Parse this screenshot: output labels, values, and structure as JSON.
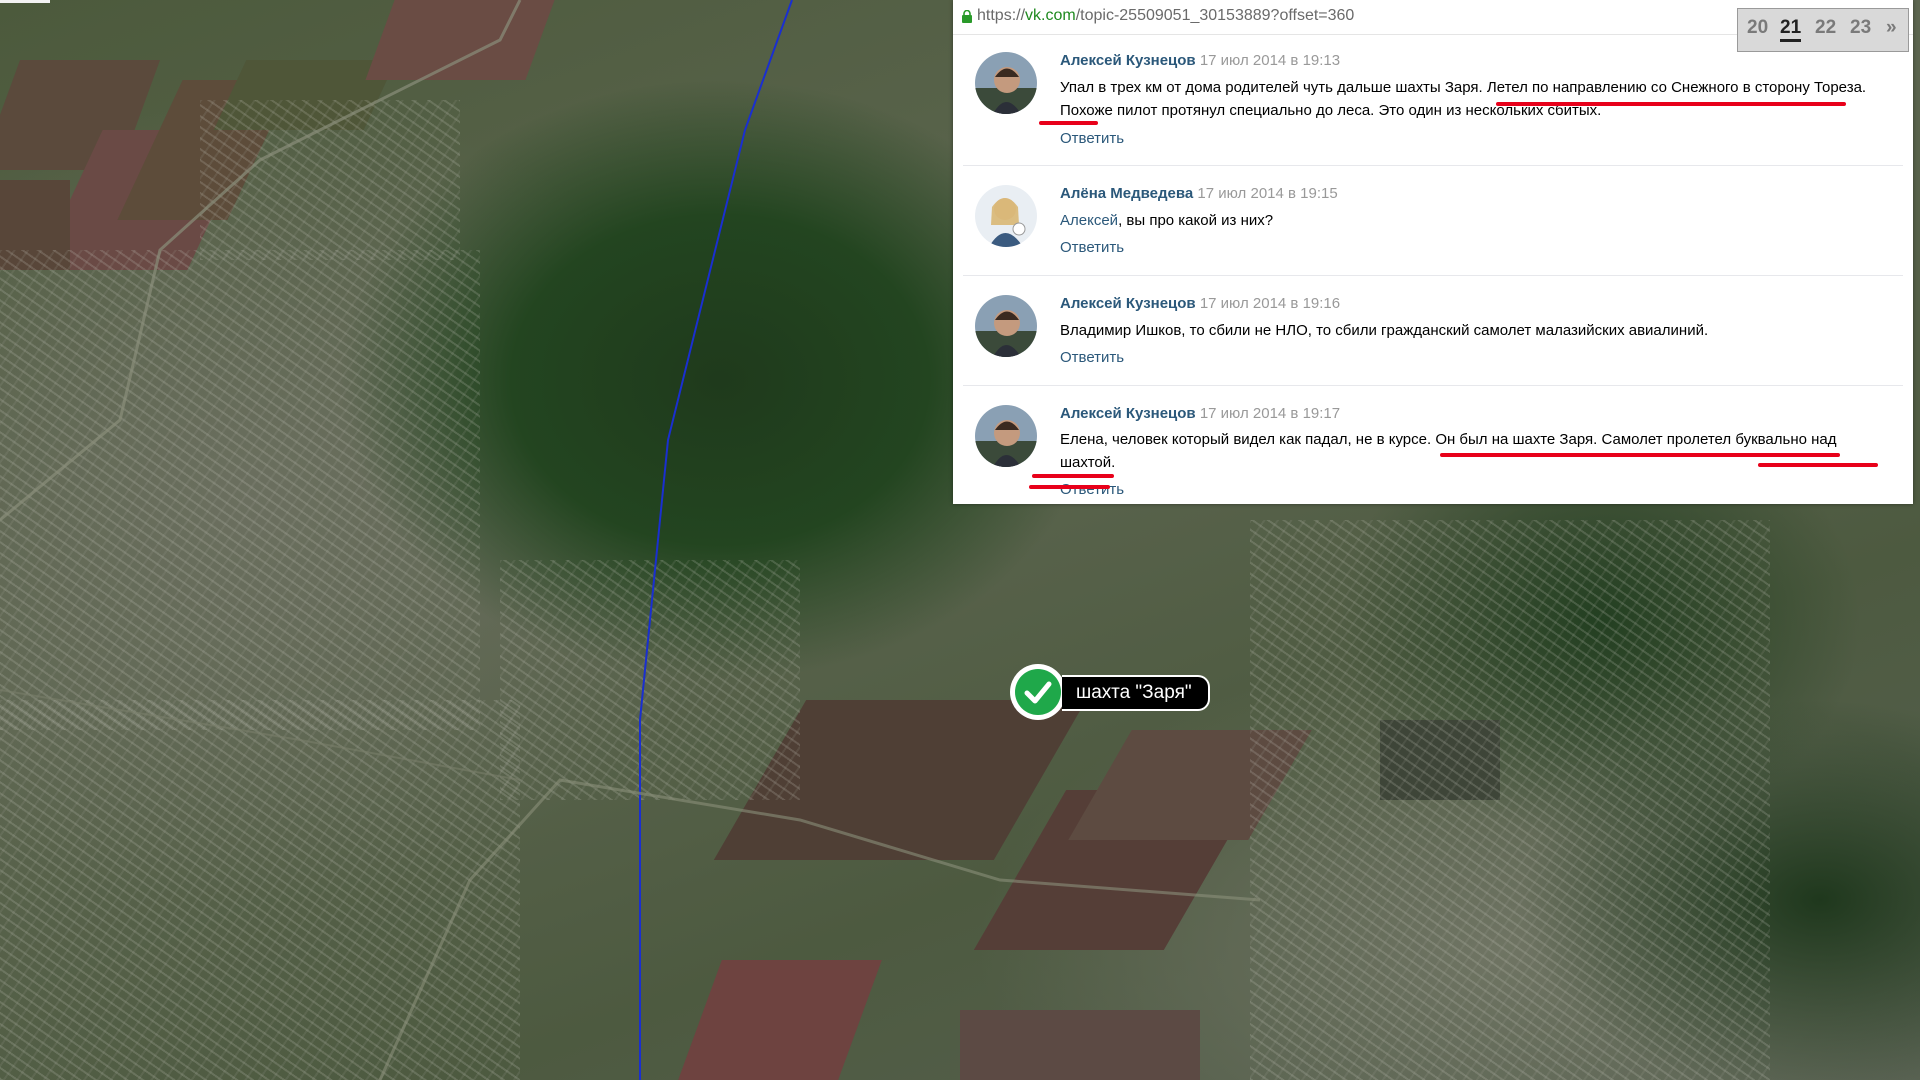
{
  "browser": {
    "url_scheme": "https://",
    "url_host": "vk.com",
    "url_path": "/topic-25509051_30153889?offset=360"
  },
  "pagination": {
    "pages": [
      "20",
      "21",
      "22",
      "23"
    ],
    "current": "21",
    "next": "»"
  },
  "comments": [
    {
      "author": "Алексей Кузнецов",
      "date": "17 июл 2014 в 19:13",
      "text_before": "Упал в трех км от дома родителей чуть дальше шахты Заря. ",
      "text_highlight": "Летел по направлению со Снежного в сторону Тореза",
      "text_after": ". Похоже пилот протянул специально до леса. Это один из нескольких сбитых.",
      "reply_label": "Ответить"
    },
    {
      "author": "Алёна Медведева",
      "date": "17 июл 2014 в 19:15",
      "mention": "Алексей",
      "text_after": ", вы про какой из них?",
      "reply_label": "Ответить"
    },
    {
      "author": "Алексей Кузнецов",
      "date": "17 июл 2014 в 19:16",
      "text_before": "Владимир Ишков, то сбили не НЛО, то сбили гражданский самолет малазийских авиалиний.",
      "reply_label": "Ответить"
    },
    {
      "author": "Алексей Кузнецов",
      "date": "17 июл 2014 в 19:17",
      "text_before": "Елена, человек который видел как падал, не в курсе. ",
      "text_highlight": "Он был на шахте Заря. Самолет пролетел буквально над шахтой",
      "text_after": ".",
      "reply_label": "Ответить"
    }
  ],
  "map": {
    "placemark_label": "шахта \"Заря\"",
    "placemark_icon": "checkmark-icon",
    "track_color": "#1a2fd0",
    "highlight_color": "#e8001a"
  }
}
